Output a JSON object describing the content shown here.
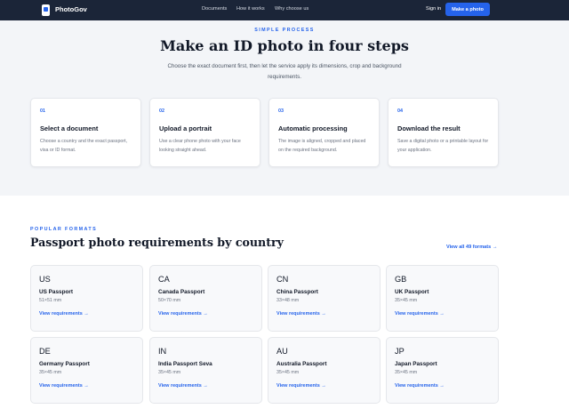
{
  "header": {
    "brand": "PhotoGov",
    "nav": [
      "Documents",
      "How it works",
      "Why choose us"
    ],
    "signin": "Sign in",
    "cta": "Make a photo"
  },
  "process": {
    "eyebrow": "SIMPLE PROCESS",
    "title": "Make an ID photo in four steps",
    "lead": "Choose the exact document first, then let the service apply its dimensions, crop and background requirements.",
    "steps": [
      {
        "num": "01",
        "title": "Select a document",
        "desc": "Choose a country and the exact passport, visa or ID format."
      },
      {
        "num": "02",
        "title": "Upload a portrait",
        "desc": "Use a clear phone photo with your face looking straight ahead."
      },
      {
        "num": "03",
        "title": "Automatic processing",
        "desc": "The image is aligned, cropped and placed on the required background."
      },
      {
        "num": "04",
        "title": "Download the result",
        "desc": "Save a digital photo or a printable layout for your application."
      }
    ]
  },
  "formats": {
    "eyebrow": "POPULAR FORMATS",
    "title": "Passport photo requirements by country",
    "view_all": "View all 49 formats →",
    "cards": [
      {
        "code": "US",
        "name": "US Passport",
        "size": "51×51 mm",
        "link": "View requirements →"
      },
      {
        "code": "CA",
        "name": "Canada Passport",
        "size": "50×70 mm",
        "link": "View requirements →"
      },
      {
        "code": "CN",
        "name": "China Passport",
        "size": "33×48 mm",
        "link": "View requirements →"
      },
      {
        "code": "GB",
        "name": "UK Passport",
        "size": "35×45 mm",
        "link": "View requirements →"
      },
      {
        "code": "DE",
        "name": "Germany Passport",
        "size": "35×45 mm",
        "link": "View requirements →"
      },
      {
        "code": "IN",
        "name": "India Passport Seva",
        "size": "35×45 mm",
        "link": "View requirements →"
      },
      {
        "code": "AU",
        "name": "Australia Passport",
        "size": "35×45 mm",
        "link": "View requirements →"
      },
      {
        "code": "JP",
        "name": "Japan Passport",
        "size": "35×45 mm",
        "link": "View requirements →"
      }
    ]
  }
}
